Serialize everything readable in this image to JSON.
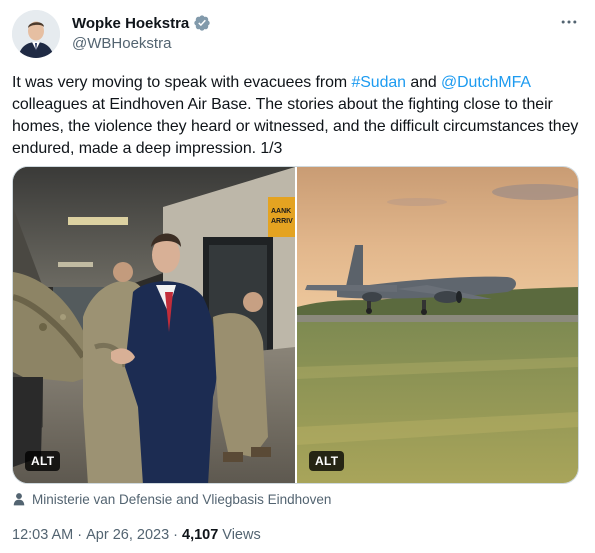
{
  "author": {
    "name": "Wopke Hoekstra",
    "handle": "@WBHoekstra",
    "avatar_icon": "avatar-man-in-suit",
    "verified_icon": "verified-badge-icon"
  },
  "tweet": {
    "text_1": "It was very moving to speak with evacuees from ",
    "link_sudan": "#Sudan",
    "text_2": " and ",
    "link_dutchmfa": "@DutchMFA",
    "text_3": " colleagues at Eindhoven Air Base. The stories about the fighting close to their homes, the violence they heard or witnessed, and the difficult circumstances they endured, made a deep impression. 1/3"
  },
  "media": {
    "photo1": {
      "alt_label": "ALT",
      "sign_text_1": "AANK",
      "sign_text_2": "ARRIV"
    },
    "photo2": {
      "alt_label": "ALT"
    }
  },
  "credit": {
    "icon": "person-icon",
    "text": "Ministerie van Defensie and Vliegbasis Eindhoven"
  },
  "meta": {
    "time": "12:03 AM",
    "separator": "·",
    "date": "Apr 26, 2023",
    "views_count": "4,107",
    "views_label": "Views"
  },
  "colors": {
    "link": "#1d9bf0",
    "verified": "#829aab",
    "secondary_text": "#536471",
    "primary_text": "#0f1419"
  }
}
